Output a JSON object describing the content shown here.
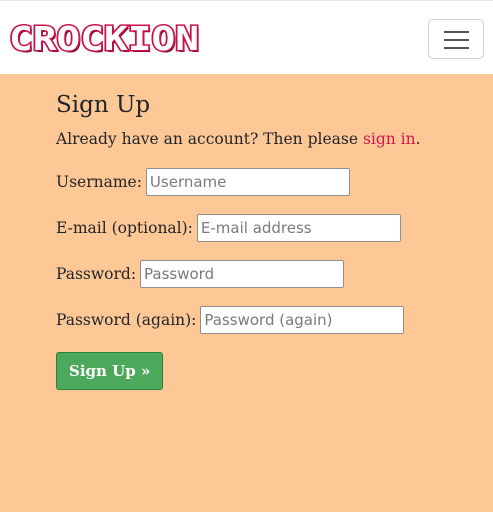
{
  "brand": {
    "logo_text": "CROCKION",
    "logo_fill": "#ffffff",
    "logo_stroke": "#c8134a",
    "logo_shadow": "#6a0a24"
  },
  "navbar": {
    "toggler_icon": "hamburger-menu-icon"
  },
  "page": {
    "title": "Sign Up",
    "lead_text": "Already have an account? Then please ",
    "signin_link": "sign in",
    "lead_end": "."
  },
  "form": {
    "username": {
      "label": "Username:",
      "placeholder": "Username",
      "value": ""
    },
    "email": {
      "label": "E-mail (optional):",
      "placeholder": "E-mail address",
      "value": ""
    },
    "password": {
      "label": "Password:",
      "placeholder": "Password",
      "value": ""
    },
    "password2": {
      "label": "Password (again):",
      "placeholder": "Password (again)",
      "value": ""
    },
    "submit_label": "Sign Up »"
  },
  "colors": {
    "background": "#fec896",
    "link": "#d5164e",
    "button": "#4ca85a"
  }
}
